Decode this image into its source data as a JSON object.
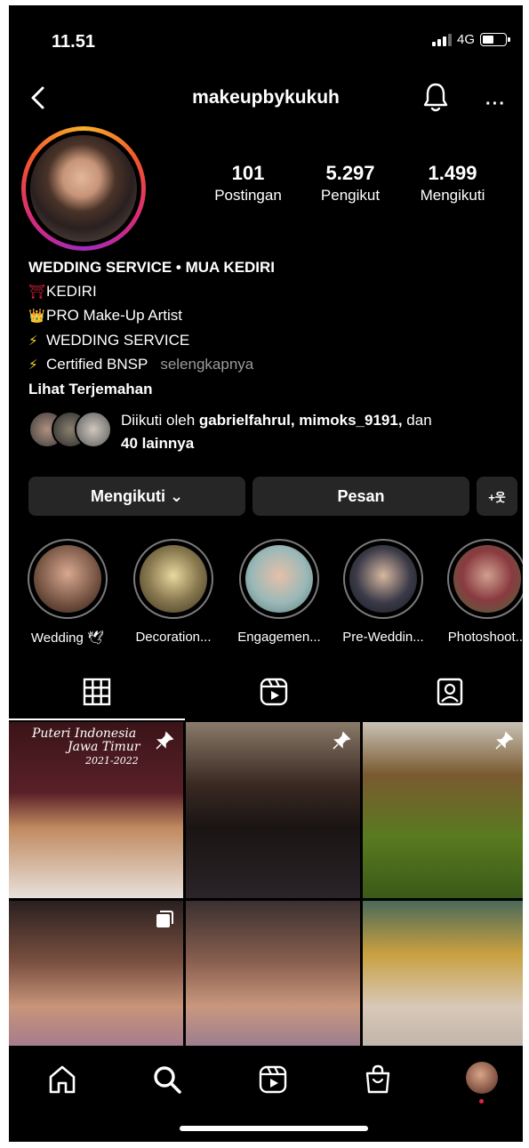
{
  "status_bar": {
    "time": "11.51",
    "network": "4G"
  },
  "header": {
    "username": "makeupbykukuh",
    "more_glyph": "···"
  },
  "stats": [
    {
      "value": "101",
      "label": "Postingan"
    },
    {
      "value": "5.297",
      "label": "Pengikut"
    },
    {
      "value": "1.499",
      "label": "Mengikuti"
    }
  ],
  "bio": {
    "name": "WEDDING SERVICE • MUA KEDIRI",
    "lines": [
      {
        "emoji": "⛩",
        "text": "KEDIRI"
      },
      {
        "emoji": "👑",
        "text": "PRO Make-Up Artist"
      },
      {
        "emoji": "⚡",
        "text": "WEDDING SERVICE"
      },
      {
        "emoji": "⚡",
        "text": "Certified BNSP"
      }
    ],
    "more_label": "selengkapnya",
    "translate_label": "Lihat Terjemahan"
  },
  "followed_by": {
    "prefix": "Diikuti oleh",
    "users": "gabrielfahrul, mimoks_9191,",
    "conj": "dan",
    "others": "40 lainnya"
  },
  "buttons": {
    "following": "Mengikuti ⌄",
    "message": "Pesan",
    "add_person": "+웃"
  },
  "highlights": [
    {
      "label": "Wedding 🕊",
      "color": "#b98a7a"
    },
    {
      "label": "Decoration...",
      "color": "#6a6a4a"
    },
    {
      "label": "Engagemen...",
      "color": "#8ab0b0"
    },
    {
      "label": "Pre-Weddin...",
      "color": "#3a3a48"
    },
    {
      "label": "Photoshoot...",
      "color": "#7a4a40"
    }
  ],
  "posts": [
    {
      "type": "pinned",
      "caption_lines": [
        "Puteri Indonesia",
        "Jawa Timur",
        "2021-2022"
      ],
      "bg": "linear-gradient(180deg,#3a1418 0%,#5a2028 40%,#c08a60 60%,#e8e0da 100%)"
    },
    {
      "type": "pinned",
      "caption_lines": [],
      "bg": "linear-gradient(180deg,#8a7a6a 0%,#3a2a22 35%,#1a1414 60%,#2a2428 100%)"
    },
    {
      "type": "pinned",
      "caption_lines": [],
      "bg": "linear-gradient(180deg,#c9c2b6 0%,#7a5a30 30%,#5a7a20 65%,#3a5a18 100%)"
    },
    {
      "type": "multi",
      "caption_lines": [],
      "bg": "linear-gradient(180deg,#2a2020 0%,#7a5040 35%,#c8947a 60%,#8a6a9a 100%)"
    },
    {
      "type": "plain",
      "caption_lines": [],
      "bg": "linear-gradient(180deg,#3a3030 0%,#8a6050 35%,#c9977e 60%,#7a6a9a 100%)"
    },
    {
      "type": "plain",
      "caption_lines": [],
      "bg": "linear-gradient(180deg,#4a6a5a 0%,#c8a040 30%,#d8c8b8 60%,#b0a8a0 100%)"
    }
  ]
}
